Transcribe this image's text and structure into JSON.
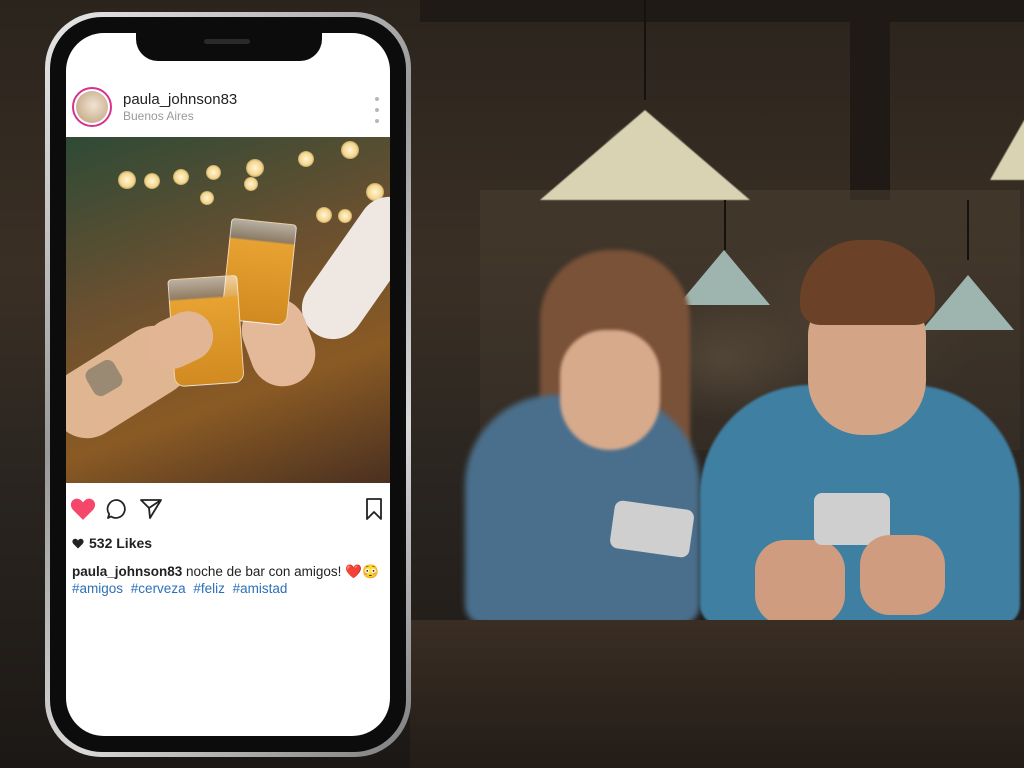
{
  "post": {
    "username": "paula_johnson83",
    "location": "Buenos Aires",
    "likes": "532 Likes",
    "caption": {
      "username": "paula_johnson83",
      "text": "noche de bar con amigos! ❤️😳",
      "hashtags": [
        "#amigos",
        "#cerveza",
        "#feliz",
        "#amistad"
      ]
    },
    "liked": true
  },
  "icons": {
    "like": "heart-icon",
    "comment": "comment-icon",
    "share": "send-icon",
    "save": "bookmark-icon",
    "more": "more-vertical-icon"
  },
  "colors": {
    "like": "#f5476a",
    "hashtag": "#2e70b8",
    "avatar_ring": "#d6338d"
  }
}
